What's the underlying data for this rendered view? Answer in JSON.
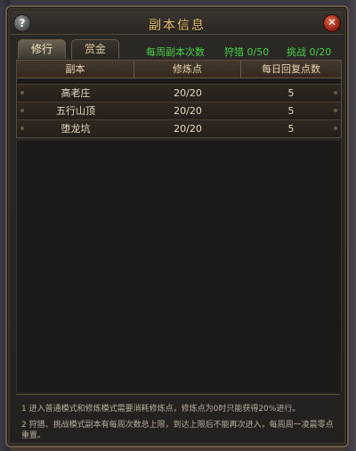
{
  "window": {
    "title": "副本信息",
    "help_label": "?",
    "close_label": "✕"
  },
  "tabs": [
    {
      "label": "修行",
      "active": true
    },
    {
      "label": "赏金",
      "active": false
    }
  ],
  "stats": {
    "weekly_label": "每周副本次数",
    "pick_label": "狩猎 0/50",
    "challenge_label": "挑战 0/20"
  },
  "table": {
    "headers": [
      "副本",
      "修炼点",
      "每日回复点数"
    ],
    "rows": [
      [
        "高老庄",
        "20/20",
        "5"
      ],
      [
        "五行山顶",
        "20/20",
        "5"
      ],
      [
        "堕龙坑",
        "20/20",
        "5"
      ]
    ]
  },
  "notes": [
    "1 进入普通模式和修炼模式需要消耗修炼点，修炼点为0时只能获得20%进行。",
    "2 狩猎、挑战模式副本有每周次数总上限，到达上限后不能再次进入，每周周一凌晨零点重置。"
  ],
  "colors": {
    "title": "#e9c878",
    "stat_green": "#48d047",
    "panel_border": "#6b5a45"
  }
}
